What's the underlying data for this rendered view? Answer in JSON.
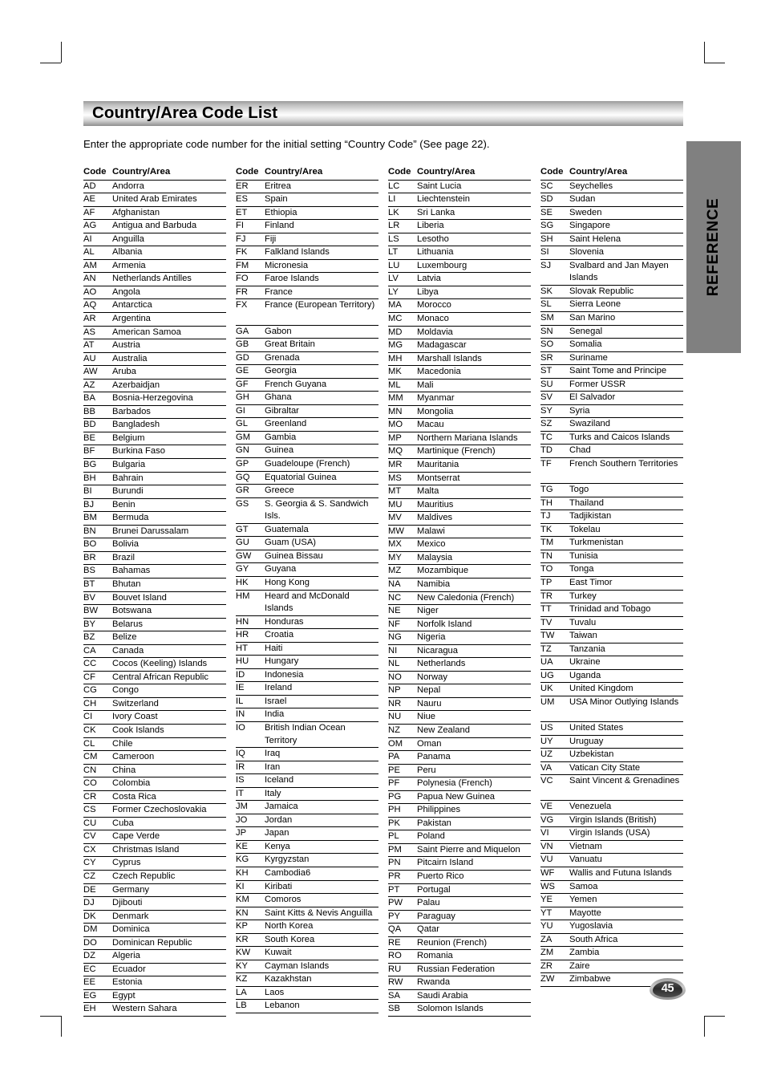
{
  "page": {
    "title": "Country/Area Code List",
    "intro": "Enter the appropriate code number for the initial setting “Country Code” (See page 22).",
    "side_tab_label": "REFERENCE",
    "page_number": "45"
  },
  "table": {
    "headers": {
      "code": "Code",
      "country": "Country/Area"
    },
    "columns": [
      [
        {
          "code": "AD",
          "name": "Andorra"
        },
        {
          "code": "AE",
          "name": "United Arab Emirates"
        },
        {
          "code": "AF",
          "name": "Afghanistan"
        },
        {
          "code": "AG",
          "name": "Antigua and Barbuda"
        },
        {
          "code": "AI",
          "name": "Anguilla"
        },
        {
          "code": "AL",
          "name": "Albania"
        },
        {
          "code": "AM",
          "name": "Armenia"
        },
        {
          "code": "AN",
          "name": "Netherlands Antilles"
        },
        {
          "code": "AO",
          "name": "Angola"
        },
        {
          "code": "AQ",
          "name": "Antarctica"
        },
        {
          "code": "AR",
          "name": "Argentina"
        },
        {
          "code": "AS",
          "name": "American Samoa"
        },
        {
          "code": "AT",
          "name": "Austria"
        },
        {
          "code": "AU",
          "name": "Australia"
        },
        {
          "code": "AW",
          "name": "Aruba"
        },
        {
          "code": "AZ",
          "name": "Azerbaidjan"
        },
        {
          "code": "BA",
          "name": "Bosnia-Herzegovina"
        },
        {
          "code": "BB",
          "name": "Barbados"
        },
        {
          "code": "BD",
          "name": "Bangladesh"
        },
        {
          "code": "BE",
          "name": "Belgium"
        },
        {
          "code": "BF",
          "name": "Burkina Faso"
        },
        {
          "code": "BG",
          "name": "Bulgaria"
        },
        {
          "code": "BH",
          "name": "Bahrain"
        },
        {
          "code": "BI",
          "name": "Burundi"
        },
        {
          "code": "BJ",
          "name": "Benin"
        },
        {
          "code": "BM",
          "name": "Bermuda"
        },
        {
          "code": "BN",
          "name": "Brunei Darussalam"
        },
        {
          "code": "BO",
          "name": "Bolivia"
        },
        {
          "code": "BR",
          "name": "Brazil"
        },
        {
          "code": "BS",
          "name": "Bahamas"
        },
        {
          "code": "BT",
          "name": "Bhutan"
        },
        {
          "code": "BV",
          "name": "Bouvet Island"
        },
        {
          "code": "BW",
          "name": "Botswana"
        },
        {
          "code": "BY",
          "name": "Belarus"
        },
        {
          "code": "BZ",
          "name": "Belize"
        },
        {
          "code": "CA",
          "name": "Canada"
        },
        {
          "code": "CC",
          "name": "Cocos (Keeling) Islands"
        },
        {
          "code": "CF",
          "name": "Central African Republic"
        },
        {
          "code": "CG",
          "name": "Congo"
        },
        {
          "code": "CH",
          "name": "Switzerland"
        },
        {
          "code": "CI",
          "name": "Ivory Coast"
        },
        {
          "code": "CK",
          "name": "Cook Islands"
        },
        {
          "code": "CL",
          "name": "Chile"
        },
        {
          "code": "CM",
          "name": "Cameroon"
        },
        {
          "code": "CN",
          "name": "China"
        },
        {
          "code": "CO",
          "name": "Colombia"
        },
        {
          "code": "CR",
          "name": "Costa Rica"
        },
        {
          "code": "CS",
          "name": "Former Czechoslovakia"
        },
        {
          "code": "CU",
          "name": "Cuba"
        },
        {
          "code": "CV",
          "name": "Cape Verde"
        },
        {
          "code": "CX",
          "name": "Christmas Island"
        },
        {
          "code": "CY",
          "name": "Cyprus"
        },
        {
          "code": "CZ",
          "name": "Czech Republic"
        },
        {
          "code": "DE",
          "name": "Germany"
        },
        {
          "code": "DJ",
          "name": "Djibouti"
        },
        {
          "code": "DK",
          "name": "Denmark"
        },
        {
          "code": "DM",
          "name": "Dominica"
        },
        {
          "code": "DO",
          "name": "Dominican Republic"
        },
        {
          "code": "DZ",
          "name": "Algeria"
        },
        {
          "code": "EC",
          "name": "Ecuador"
        },
        {
          "code": "EE",
          "name": "Estonia"
        },
        {
          "code": "EG",
          "name": "Egypt"
        },
        {
          "code": "EH",
          "name": "Western Sahara"
        }
      ],
      [
        {
          "code": "ER",
          "name": "Eritrea"
        },
        {
          "code": "ES",
          "name": "Spain"
        },
        {
          "code": "ET",
          "name": "Ethiopia"
        },
        {
          "code": "FI",
          "name": "Finland"
        },
        {
          "code": "FJ",
          "name": "Fiji"
        },
        {
          "code": "FK",
          "name": "Falkland Islands"
        },
        {
          "code": "FM",
          "name": "Micronesia"
        },
        {
          "code": "FO",
          "name": "Faroe Islands"
        },
        {
          "code": "FR",
          "name": "France"
        },
        {
          "code": "FX",
          "name": "France (European Territory)",
          "tall": true
        },
        {
          "code": "GA",
          "name": "Gabon"
        },
        {
          "code": "GB",
          "name": "Great Britain"
        },
        {
          "code": "GD",
          "name": "Grenada"
        },
        {
          "code": "GE",
          "name": "Georgia"
        },
        {
          "code": "GF",
          "name": "French Guyana"
        },
        {
          "code": "GH",
          "name": "Ghana"
        },
        {
          "code": "GI",
          "name": "Gibraltar"
        },
        {
          "code": "GL",
          "name": "Greenland"
        },
        {
          "code": "GM",
          "name": "Gambia"
        },
        {
          "code": "GN",
          "name": "Guinea"
        },
        {
          "code": "GP",
          "name": "Guadeloupe (French)"
        },
        {
          "code": "GQ",
          "name": "Equatorial Guinea"
        },
        {
          "code": "GR",
          "name": "Greece"
        },
        {
          "code": "GS",
          "name": "S. Georgia & S. Sandwich Isls.",
          "tall": true
        },
        {
          "code": "GT",
          "name": "Guatemala"
        },
        {
          "code": "GU",
          "name": "Guam (USA)"
        },
        {
          "code": "GW",
          "name": "Guinea Bissau"
        },
        {
          "code": "GY",
          "name": "Guyana"
        },
        {
          "code": "HK",
          "name": "Hong Kong"
        },
        {
          "code": "HM",
          "name": "Heard and McDonald Islands",
          "tall": true
        },
        {
          "code": "HN",
          "name": "Honduras"
        },
        {
          "code": "HR",
          "name": "Croatia"
        },
        {
          "code": "HT",
          "name": "Haiti"
        },
        {
          "code": "HU",
          "name": "Hungary"
        },
        {
          "code": "ID",
          "name": "Indonesia"
        },
        {
          "code": "IE",
          "name": "Ireland"
        },
        {
          "code": "IL",
          "name": "Israel"
        },
        {
          "code": "IN",
          "name": "India"
        },
        {
          "code": "IO",
          "name": "British Indian Ocean Territory",
          "tall": true
        },
        {
          "code": "IQ",
          "name": "Iraq"
        },
        {
          "code": "IR",
          "name": "Iran"
        },
        {
          "code": "IS",
          "name": "Iceland"
        },
        {
          "code": "IT",
          "name": "Italy"
        },
        {
          "code": "JM",
          "name": "Jamaica"
        },
        {
          "code": "JO",
          "name": "Jordan"
        },
        {
          "code": "JP",
          "name": "Japan"
        },
        {
          "code": "KE",
          "name": "Kenya"
        },
        {
          "code": "KG",
          "name": "Kyrgyzstan"
        },
        {
          "code": "KH",
          "name": "Cambodia6"
        },
        {
          "code": "KI",
          "name": "Kiribati"
        },
        {
          "code": "KM",
          "name": "Comoros"
        },
        {
          "code": "KN",
          "name": "Saint Kitts & Nevis Anguilla"
        },
        {
          "code": "KP",
          "name": "North Korea"
        },
        {
          "code": "KR",
          "name": "South Korea"
        },
        {
          "code": "KW",
          "name": "Kuwait"
        },
        {
          "code": "KY",
          "name": "Cayman Islands"
        },
        {
          "code": "KZ",
          "name": "Kazakhstan"
        },
        {
          "code": "LA",
          "name": "Laos"
        },
        {
          "code": "LB",
          "name": "Lebanon"
        }
      ],
      [
        {
          "code": "LC",
          "name": "Saint Lucia"
        },
        {
          "code": "LI",
          "name": "Liechtenstein"
        },
        {
          "code": "LK",
          "name": "Sri Lanka"
        },
        {
          "code": "LR",
          "name": "Liberia"
        },
        {
          "code": "LS",
          "name": "Lesotho"
        },
        {
          "code": "LT",
          "name": "Lithuania"
        },
        {
          "code": "LU",
          "name": "Luxembourg"
        },
        {
          "code": "LV",
          "name": "Latvia"
        },
        {
          "code": "LY",
          "name": "Libya"
        },
        {
          "code": "MA",
          "name": "Morocco"
        },
        {
          "code": "MC",
          "name": "Monaco"
        },
        {
          "code": "MD",
          "name": "Moldavia"
        },
        {
          "code": "MG",
          "name": "Madagascar"
        },
        {
          "code": "MH",
          "name": "Marshall Islands"
        },
        {
          "code": "MK",
          "name": "Macedonia"
        },
        {
          "code": "ML",
          "name": "Mali"
        },
        {
          "code": "MM",
          "name": "Myanmar"
        },
        {
          "code": "MN",
          "name": "Mongolia"
        },
        {
          "code": "MO",
          "name": "Macau"
        },
        {
          "code": "MP",
          "name": "Northern Mariana Islands"
        },
        {
          "code": "MQ",
          "name": "Martinique (French)"
        },
        {
          "code": "MR",
          "name": "Mauritania"
        },
        {
          "code": "MS",
          "name": "Montserrat"
        },
        {
          "code": "MT",
          "name": "Malta"
        },
        {
          "code": "MU",
          "name": "Mauritius"
        },
        {
          "code": "MV",
          "name": "Maldives"
        },
        {
          "code": "MW",
          "name": "Malawi"
        },
        {
          "code": "MX",
          "name": "Mexico"
        },
        {
          "code": "MY",
          "name": "Malaysia"
        },
        {
          "code": "MZ",
          "name": "Mozambique"
        },
        {
          "code": "NA",
          "name": "Namibia"
        },
        {
          "code": "NC",
          "name": "New Caledonia (French)"
        },
        {
          "code": "NE",
          "name": "Niger"
        },
        {
          "code": "NF",
          "name": "Norfolk Island"
        },
        {
          "code": "NG",
          "name": "Nigeria"
        },
        {
          "code": "NI",
          "name": "Nicaragua"
        },
        {
          "code": "NL",
          "name": "Netherlands"
        },
        {
          "code": "NO",
          "name": "Norway"
        },
        {
          "code": "NP",
          "name": "Nepal"
        },
        {
          "code": "NR",
          "name": "Nauru"
        },
        {
          "code": "NU",
          "name": "Niue"
        },
        {
          "code": "NZ",
          "name": "New Zealand"
        },
        {
          "code": "OM",
          "name": "Oman"
        },
        {
          "code": "PA",
          "name": "Panama"
        },
        {
          "code": "PE",
          "name": "Peru"
        },
        {
          "code": "PF",
          "name": "Polynesia (French)"
        },
        {
          "code": "PG",
          "name": "Papua New Guinea"
        },
        {
          "code": "PH",
          "name": "Philippines"
        },
        {
          "code": "PK",
          "name": "Pakistan"
        },
        {
          "code": "PL",
          "name": "Poland"
        },
        {
          "code": "PM",
          "name": "Saint Pierre and Miquelon"
        },
        {
          "code": "PN",
          "name": "Pitcairn Island"
        },
        {
          "code": "PR",
          "name": "Puerto Rico"
        },
        {
          "code": "PT",
          "name": "Portugal"
        },
        {
          "code": "PW",
          "name": "Palau"
        },
        {
          "code": "PY",
          "name": "Paraguay"
        },
        {
          "code": "QA",
          "name": "Qatar"
        },
        {
          "code": "RE",
          "name": "Reunion (French)"
        },
        {
          "code": "RO",
          "name": "Romania"
        },
        {
          "code": "RU",
          "name": "Russian Federation"
        },
        {
          "code": "RW",
          "name": "Rwanda"
        },
        {
          "code": "SA",
          "name": "Saudi Arabia"
        },
        {
          "code": "SB",
          "name": "Solomon Islands"
        }
      ],
      [
        {
          "code": "SC",
          "name": "Seychelles"
        },
        {
          "code": "SD",
          "name": "Sudan"
        },
        {
          "code": "SE",
          "name": "Sweden"
        },
        {
          "code": "SG",
          "name": "Singapore"
        },
        {
          "code": "SH",
          "name": "Saint Helena"
        },
        {
          "code": "SI",
          "name": "Slovenia"
        },
        {
          "code": "SJ",
          "name": "Svalbard and Jan Mayen Islands",
          "tall": true
        },
        {
          "code": "SK",
          "name": "Slovak Republic"
        },
        {
          "code": "SL",
          "name": "Sierra Leone"
        },
        {
          "code": "SM",
          "name": "San Marino"
        },
        {
          "code": "SN",
          "name": "Senegal"
        },
        {
          "code": "SO",
          "name": "Somalia"
        },
        {
          "code": "SR",
          "name": "Suriname"
        },
        {
          "code": "ST",
          "name": "Saint Tome and Principe"
        },
        {
          "code": "SU",
          "name": "Former USSR"
        },
        {
          "code": "SV",
          "name": "El Salvador"
        },
        {
          "code": "SY",
          "name": "Syria"
        },
        {
          "code": "SZ",
          "name": "Swaziland"
        },
        {
          "code": "TC",
          "name": "Turks and Caicos Islands"
        },
        {
          "code": "TD",
          "name": "Chad"
        },
        {
          "code": "TF",
          "name": "French Southern Territories",
          "tall": true
        },
        {
          "code": "TG",
          "name": "Togo"
        },
        {
          "code": "TH",
          "name": "Thailand"
        },
        {
          "code": "TJ",
          "name": "Tadjikistan"
        },
        {
          "code": "TK",
          "name": "Tokelau"
        },
        {
          "code": "TM",
          "name": "Turkmenistan"
        },
        {
          "code": "TN",
          "name": "Tunisia"
        },
        {
          "code": "TO",
          "name": "Tonga"
        },
        {
          "code": "TP",
          "name": "East Timor"
        },
        {
          "code": "TR",
          "name": "Turkey"
        },
        {
          "code": "TT",
          "name": "Trinidad and Tobago"
        },
        {
          "code": "TV",
          "name": "Tuvalu"
        },
        {
          "code": "TW",
          "name": "Taiwan"
        },
        {
          "code": "TZ",
          "name": "Tanzania"
        },
        {
          "code": "UA",
          "name": "Ukraine"
        },
        {
          "code": "UG",
          "name": "Uganda"
        },
        {
          "code": "UK",
          "name": "United Kingdom"
        },
        {
          "code": "UM",
          "name": "USA Minor Outlying Islands",
          "tall": true
        },
        {
          "code": "US",
          "name": "United States"
        },
        {
          "code": "UY",
          "name": "Uruguay"
        },
        {
          "code": "UZ",
          "name": "Uzbekistan"
        },
        {
          "code": "VA",
          "name": "Vatican City State"
        },
        {
          "code": "VC",
          "name": "Saint Vincent & Grenadines",
          "tall": true
        },
        {
          "code": "VE",
          "name": "Venezuela"
        },
        {
          "code": "VG",
          "name": "Virgin Islands (British)"
        },
        {
          "code": "VI",
          "name": "Virgin Islands (USA)"
        },
        {
          "code": "VN",
          "name": "Vietnam"
        },
        {
          "code": "VU",
          "name": "Vanuatu"
        },
        {
          "code": "WF",
          "name": "Wallis and Futuna Islands"
        },
        {
          "code": "WS",
          "name": "Samoa"
        },
        {
          "code": "YE",
          "name": "Yemen"
        },
        {
          "code": "YT",
          "name": "Mayotte"
        },
        {
          "code": "YU",
          "name": "Yugoslavia"
        },
        {
          "code": "ZA",
          "name": "South Africa"
        },
        {
          "code": "ZM",
          "name": "Zambia"
        },
        {
          "code": "ZR",
          "name": "Zaire"
        },
        {
          "code": "ZW",
          "name": "Zimbabwe"
        }
      ]
    ]
  }
}
